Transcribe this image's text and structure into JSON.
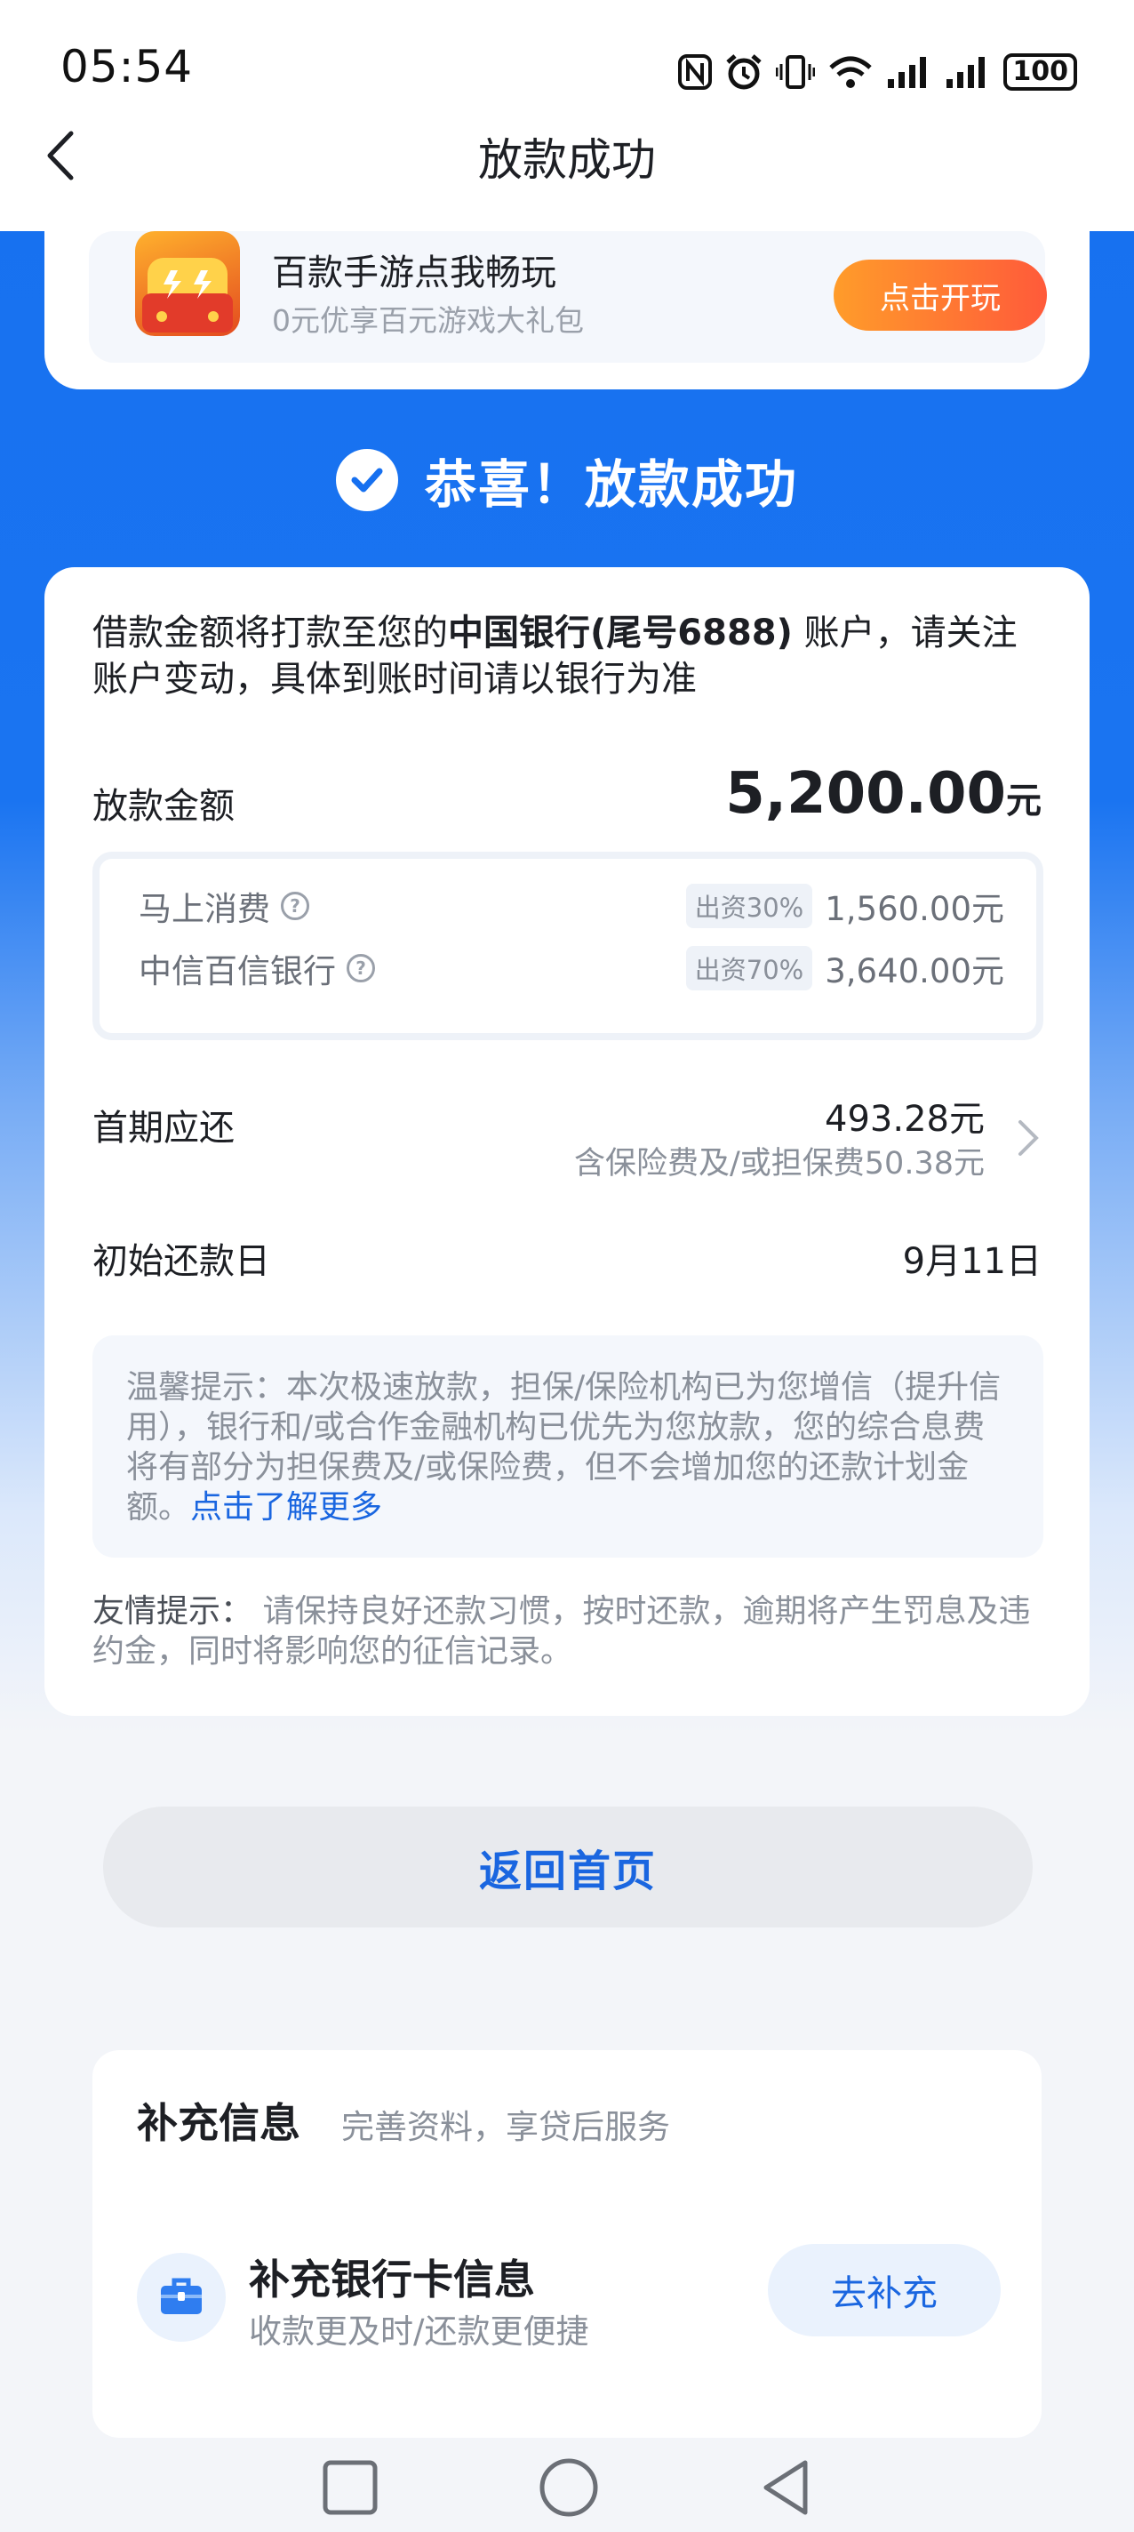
{
  "status_bar": {
    "time": "05:54",
    "battery": "100"
  },
  "header": {
    "title": "放款成功"
  },
  "ad": {
    "title": "百款手游点我畅玩",
    "subtitle": "0元优享百元游戏大礼包",
    "button": "点击开玩"
  },
  "success": {
    "text": "恭喜！放款成功"
  },
  "notice": {
    "prefix": "借款金额将打款至您的",
    "bank": "中国银行(尾号6888)",
    "suffix": " 账户，请关注账户变动，具体到账时间请以银行为准"
  },
  "loan": {
    "label": "放款金额",
    "amount": "5,200.00",
    "unit": "元",
    "funders": [
      {
        "name": "马上消费",
        "share": "出资30%",
        "value": "1,560.00元"
      },
      {
        "name": "中信百信银行",
        "share": "出资70%",
        "value": "3,640.00元"
      }
    ]
  },
  "first_payment": {
    "label": "首期应还",
    "amount": "493.28元",
    "note": "含保险费及/或担保费50.38元"
  },
  "start_date": {
    "label": "初始还款日",
    "value": "9月11日"
  },
  "tip": {
    "text": "温馨提示：本次极速放款，担保/保险机构已为您增信（提升信用），银行和/或合作金融机构已优先为您放款，您的综合息费将有部分为担保费及/或保险费，但不会增加您的还款计划金额。",
    "link": "点击了解更多"
  },
  "friendly": {
    "label": "友情提示：",
    "text": " 请保持良好还款习惯，按时还款，逾期将产生罚息及违约金，同时将影响您的征信记录。"
  },
  "home_button": "返回首页",
  "supplement": {
    "title": "补充信息",
    "subtitle": "完善资料，享贷后服务",
    "item_title": "补充银行卡信息",
    "item_subtitle": "收款更及时/还款更便捷",
    "button": "去补充"
  },
  "icons": [
    "nfc-icon",
    "alarm-icon",
    "vibrate-icon",
    "wifi-icon",
    "signal-icon",
    "back-icon",
    "check-icon",
    "help-icon",
    "chevron-right-icon",
    "briefcase-icon",
    "recent-apps-icon",
    "home-icon",
    "back-triangle-icon"
  ],
  "colors": {
    "primary": "#1a66e0",
    "header_blue": "#1670f0",
    "ad_button": "#ff7a30"
  }
}
